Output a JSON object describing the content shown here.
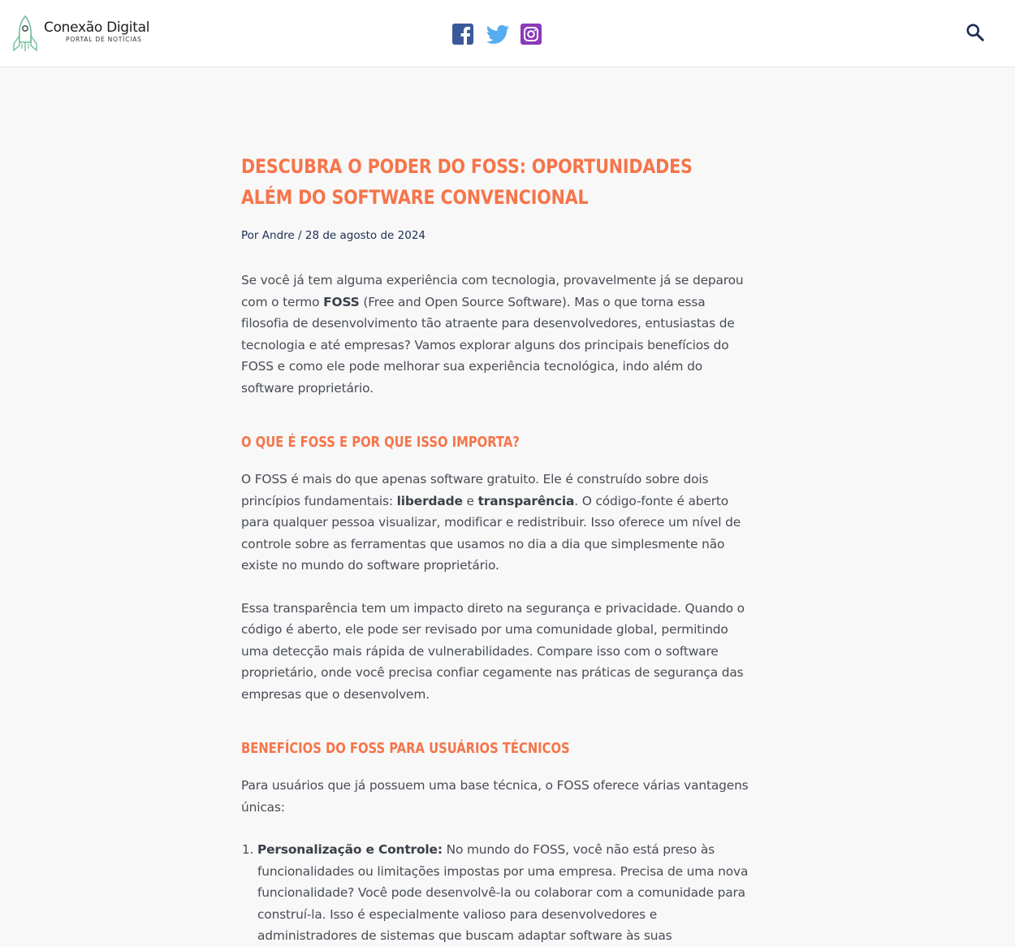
{
  "header": {
    "site_name": "Conexão Digital",
    "site_tagline": "PORTAL DE NOTÍCIAS",
    "social": [
      {
        "name": "facebook-icon",
        "color": "#3b5998"
      },
      {
        "name": "twitter-icon",
        "color": "#55acee"
      },
      {
        "name": "instagram-icon",
        "color": "#8a3ab9"
      }
    ],
    "search_icon": "search-icon"
  },
  "article": {
    "title": "Descubra o poder do FOSS: Oportunidades além do software convencional",
    "meta_by": "Por",
    "author": "Andre",
    "separator": "/",
    "date": "28 de agosto de 2024",
    "intro": {
      "before": "Se você já tem alguma experiência com tecnologia, provavelmente já se deparou com o termo ",
      "bold": "FOSS",
      "after": " (Free and Open Source Software). Mas o que torna essa filosofia de desenvolvimento tão atraente para desenvolvedores, entusiastas de tecnologia e até empresas? Vamos explorar alguns dos principais benefícios do FOSS e como ele pode melhorar sua experiência tecnológica, indo além do software proprietário."
    },
    "section1": {
      "heading": "O que é FOSS e por que isso importa?",
      "p1": {
        "before": "O FOSS é mais do que apenas software gratuito. Ele é construído sobre dois princípios fundamentais: ",
        "bold1": "liberdade",
        "mid": " e ",
        "bold2": "transparência",
        "after": ". O código-fonte é aberto para qualquer pessoa visualizar, modificar e redistribuir. Isso oferece um nível de controle sobre as ferramentas que usamos no dia a dia que simplesmente não existe no mundo do software proprietário."
      },
      "p2": "Essa transparência tem um impacto direto na segurança e privacidade. Quando o código é aberto, ele pode ser revisado por uma comunidade global, permitindo uma detecção mais rápida de vulnerabilidades. Compare isso com o software proprietário, onde você precisa confiar cegamente nas práticas de segurança das empresas que o desenvolvem."
    },
    "section2": {
      "heading": "Benefícios do FOSS para usuários técnicos",
      "p1": "Para usuários que já possuem uma base técnica, o FOSS oferece várias vantagens únicas:",
      "list": [
        {
          "bold": "Personalização e Controle:",
          "text": " No mundo do FOSS, você não está preso às funcionalidades ou limitações impostas por uma empresa. Precisa de uma nova funcionalidade? Você pode desenvolvê-la ou colaborar com a comunidade para construí-la. Isso é especialmente valioso para desenvolvedores e administradores de sistemas que buscam adaptar software às suas"
        }
      ]
    }
  }
}
